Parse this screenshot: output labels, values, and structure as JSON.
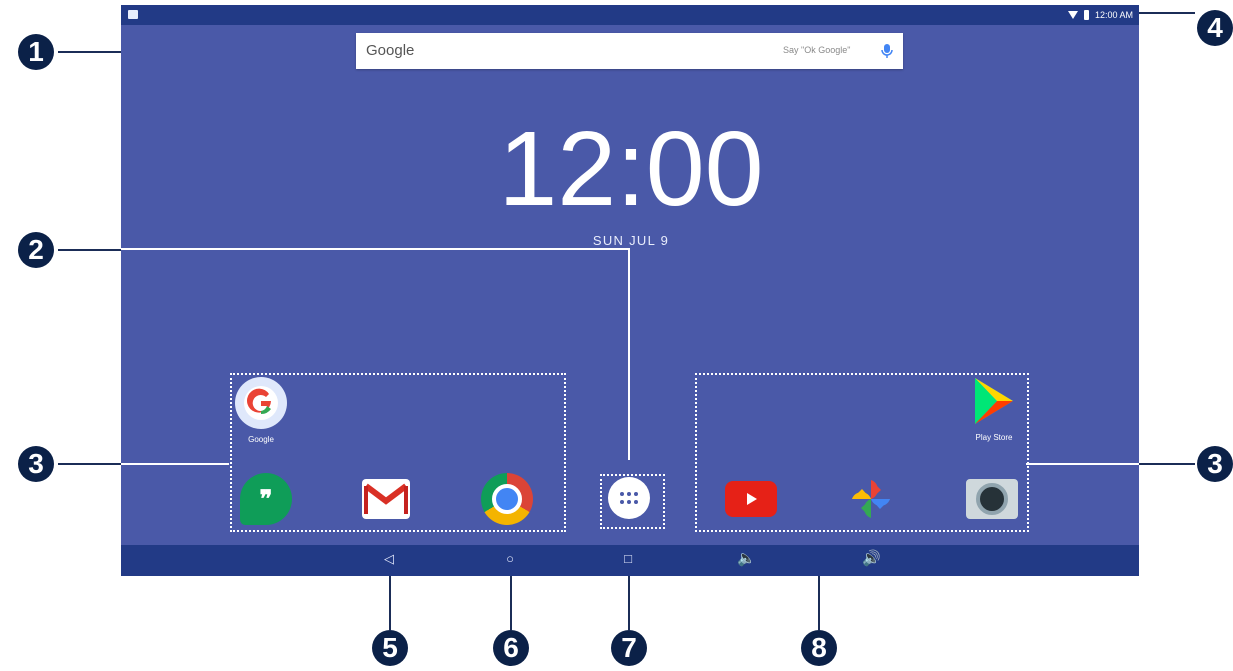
{
  "screen": {
    "time": "12:00",
    "date": "SUN  JUL  9",
    "status_time": "12:00 AM"
  },
  "search": {
    "logo_text": "Google",
    "hint_text": "Say \"Ok Google\""
  },
  "apps": [
    {
      "name": "Google",
      "icon": "google-icon",
      "label": "Google"
    },
    {
      "name": "Hangouts",
      "icon": "hangouts-icon",
      "label": ""
    },
    {
      "name": "Gmail",
      "icon": "gmail-icon",
      "label": ""
    },
    {
      "name": "Chrome",
      "icon": "chrome-icon",
      "label": ""
    },
    {
      "name": "App drawer",
      "icon": "app-drawer-icon",
      "label": ""
    },
    {
      "name": "YouTube",
      "icon": "youtube-icon",
      "label": ""
    },
    {
      "name": "Photos",
      "icon": "photos-icon",
      "label": ""
    },
    {
      "name": "Camera",
      "icon": "camera-icon",
      "label": ""
    },
    {
      "name": "Play Store",
      "icon": "play-store-icon",
      "label": "Play Store"
    }
  ],
  "navigation": {
    "back_icon": "back-icon",
    "home_icon": "home-icon",
    "recents_icon": "recents-icon",
    "volume_down_icon": "volume-down-icon",
    "volume_up_icon": "volume-up-icon"
  },
  "callouts": [
    "1",
    "2",
    "3",
    "3",
    "4",
    "5",
    "6",
    "7",
    "8"
  ],
  "colors": {
    "screen_bg": "#4a59a8",
    "statusbar_bg": "#223a86",
    "callout_bg": "#0b2148"
  }
}
